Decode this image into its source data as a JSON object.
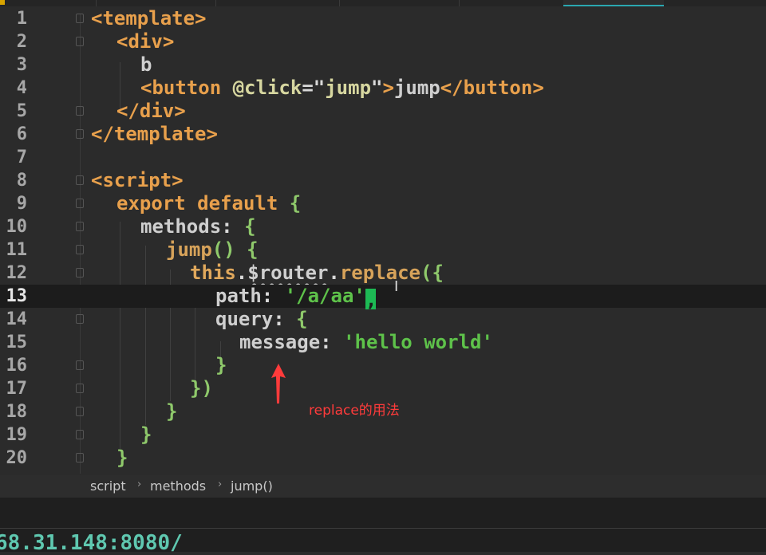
{
  "editor": {
    "current_line": 13,
    "line_numbers": [
      "1",
      "2",
      "3",
      "4",
      "5",
      "6",
      "7",
      "8",
      "9",
      "10",
      "11",
      "12",
      "13",
      "14",
      "15",
      "16",
      "17",
      "18",
      "19",
      "20"
    ],
    "lines": {
      "l1": {
        "open": "<",
        "tag": "template",
        "close": ">"
      },
      "l2": {
        "open": "<",
        "tag": "div",
        "close": ">"
      },
      "l3": {
        "text": "b"
      },
      "l4": {
        "open": "<",
        "tag": "button",
        "attr": "@click",
        "eq": "=",
        "q1": "\"",
        "val": "jump",
        "q2": "\"",
        "close": ">",
        "text": "jump",
        "etag_open": "</",
        "etag": "button",
        "etag_close": ">"
      },
      "l5": {
        "open": "</",
        "tag": "div",
        "close": ">"
      },
      "l6": {
        "open": "</",
        "tag": "template",
        "close": ">"
      },
      "l8": {
        "open": "<",
        "tag": "script",
        "close": ">"
      },
      "l9": {
        "kw1": "export",
        "kw2": "default",
        "brace": "{"
      },
      "l10": {
        "prop": "methods",
        "colon": ":",
        "brace": "{"
      },
      "l11": {
        "fn": "jump",
        "parens": "()",
        "brace": "{"
      },
      "l12": {
        "this": "this",
        "dot1": ".",
        "router": "$router",
        "dot2": ".",
        "fn": "replace",
        "tail": "({"
      },
      "l13": {
        "prop": "path",
        "colon": ":",
        "str": "'/a/aa'",
        "comma": ","
      },
      "l14": {
        "prop": "query",
        "colon": ":",
        "brace": "{"
      },
      "l15": {
        "prop": "message",
        "colon": ":",
        "str": "'hello world'"
      },
      "l16": {
        "brace": "}"
      },
      "l17": {
        "brace": "})"
      },
      "l18": {
        "brace": "}"
      },
      "l19": {
        "brace": "}"
      },
      "l20": {
        "brace": "}"
      }
    }
  },
  "annotation": {
    "text": "replace的用法",
    "color": "#ff3b3b"
  },
  "breadcrumb": {
    "items": [
      "script",
      "methods",
      "jump()"
    ],
    "separator": "›"
  },
  "status": {
    "address": "68.31.148:8080/"
  },
  "colors": {
    "background": "#2b2b2b",
    "tag": "#e8a04c",
    "string": "#5ec24a",
    "cursor": "#1db954",
    "address": "#5fc8b0"
  }
}
